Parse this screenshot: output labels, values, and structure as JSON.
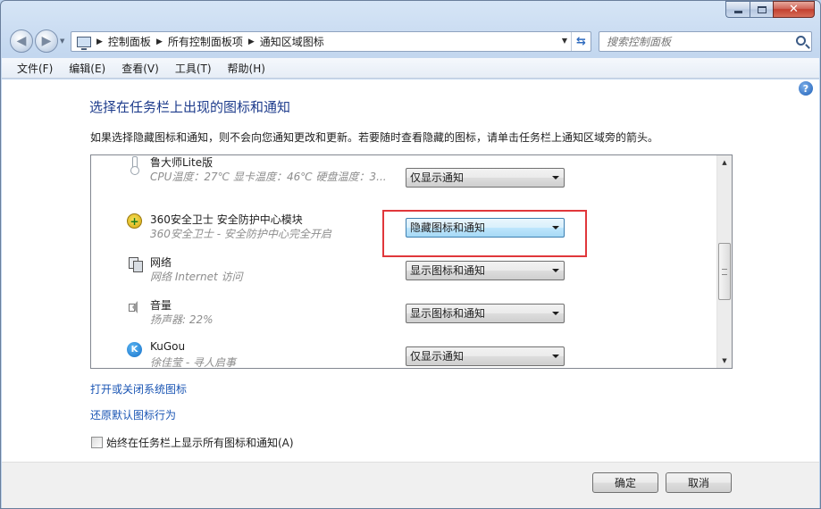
{
  "window": {
    "caption_buttons": {
      "minimize": "minimize-icon",
      "maximize": "maximize-icon",
      "close": "close-icon",
      "close_glyph": "✕"
    }
  },
  "address_bar": {
    "breadcrumbs": [
      "控制面板",
      "所有控制面板项",
      "通知区域图标"
    ]
  },
  "search": {
    "placeholder": "搜索控制面板"
  },
  "menu": [
    "文件(F)",
    "编辑(E)",
    "查看(V)",
    "工具(T)",
    "帮助(H)"
  ],
  "page": {
    "title": "选择在任务栏上出现的图标和通知",
    "description": "如果选择隐藏图标和通知，则不会向您通知更改和更新。若要随时查看隐藏的图标，请单击任务栏上通知区域旁的箭头。",
    "help_glyph": "?"
  },
  "icons_list": [
    {
      "name": "鲁大师Lite版",
      "sub": "CPU温度：27℃  显卡温度：46℃  硬盘温度：3...",
      "behavior": "仅显示通知",
      "icon": "thermometer-icon"
    },
    {
      "name": "360安全卫士 安全防护中心模块",
      "sub": "360安全卫士 - 安全防护中心完全开启",
      "behavior": "隐藏图标和通知",
      "icon": "360-shield-icon",
      "icon_glyph": "+"
    },
    {
      "name": "网络",
      "sub": "网络 Internet 访问",
      "behavior": "显示图标和通知",
      "icon": "network-icon"
    },
    {
      "name": "音量",
      "sub": "扬声器: 22%",
      "behavior": "显示图标和通知",
      "icon": "volume-icon"
    },
    {
      "name": "KuGou",
      "sub": "徐佳莹 - 寻人启事",
      "behavior": "仅显示通知",
      "icon": "kugou-icon",
      "icon_glyph": "K"
    }
  ],
  "links": {
    "system_icons": "打开或关闭系统图标",
    "restore_default": "还原默认图标行为"
  },
  "always_show": {
    "label": "始终在任务栏上显示所有图标和通知(A)",
    "checked": false
  },
  "buttons": {
    "ok": "确定",
    "cancel": "取消"
  },
  "colors": {
    "title": "#1e3c8c",
    "link": "#1a55b4",
    "highlight": "#e0373b"
  }
}
